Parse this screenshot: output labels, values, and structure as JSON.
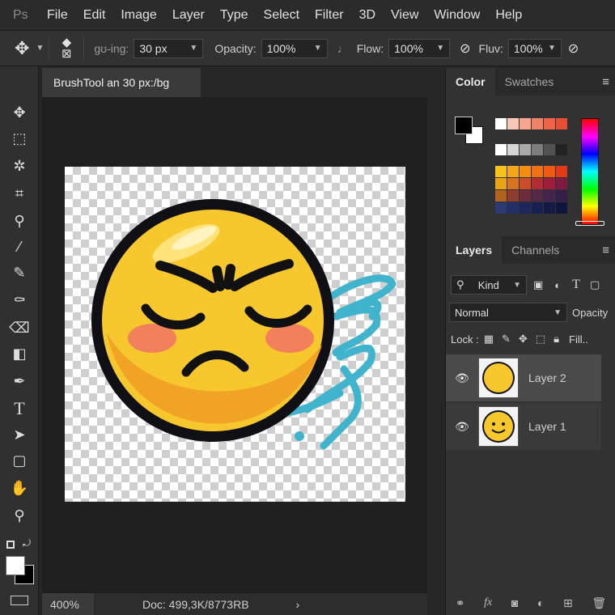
{
  "app": {
    "logo": "Ps"
  },
  "menu": [
    "File",
    "Edit",
    "Image",
    "Layer",
    "Type",
    "Select",
    "Filter",
    "3D",
    "View",
    "Window",
    "Help"
  ],
  "options": {
    "size_label": "gʊ-ing:",
    "size_value": "30 px",
    "opacity_label": "Opacity:",
    "opacity_value": "100%",
    "flow_label": "Flow:",
    "flow_value": "100%",
    "fluv_label": "Fluv:",
    "fluv_value": "100%"
  },
  "document": {
    "tab_title": "BrushTool an  30 px:/bg",
    "zoom": "400%",
    "doc_info": "Doc: 499,3K/8773RB"
  },
  "color_panel": {
    "tabs": [
      "Color",
      "Swatches"
    ],
    "foreground": "#000000",
    "background": "#ffffff",
    "swatch_rows": [
      [
        "#ffffff",
        "#f6c7b6",
        "#f4a68e",
        "#f08368",
        "#ee6449",
        "#e94e35"
      ],
      [
        "#ffffff",
        "#d6d6d6",
        "#a9a9a9",
        "#7d7d7d",
        "#525252",
        "#222222"
      ],
      [
        "#f6c31a",
        "#f5a817",
        "#f28e14",
        "#f07313",
        "#ec5a14",
        "#e43a17"
      ],
      [
        "#e8a516",
        "#d9731d",
        "#c94d2a",
        "#b42c34",
        "#9e1d3a",
        "#7e1a3e"
      ],
      [
        "#b0631f",
        "#8e3d2f",
        "#6d2b3b",
        "#562747",
        "#43244e",
        "#341f49"
      ],
      [
        "#2b3a72",
        "#223067",
        "#1c275b",
        "#172050",
        "#131a45",
        "#10163b"
      ]
    ]
  },
  "layers_panel": {
    "tabs": [
      "Layers",
      "Channels"
    ],
    "filter_kind": "Kind",
    "blend_mode": "Normal",
    "opacity_label": "Opacity",
    "lock_label": "Lock :",
    "fill_label": "Fill..",
    "layers": [
      {
        "name": "Layer 2",
        "selected": true
      },
      {
        "name": "Layer 1",
        "selected": false
      }
    ]
  }
}
